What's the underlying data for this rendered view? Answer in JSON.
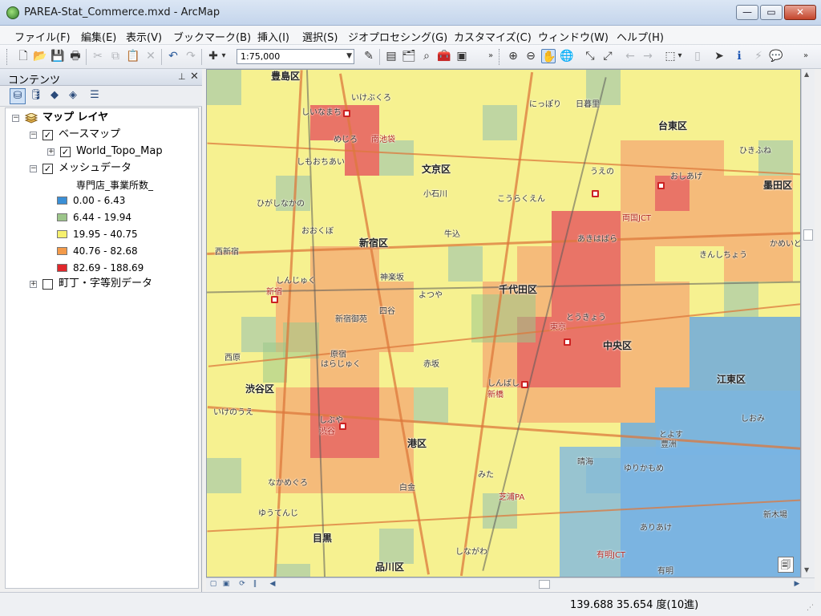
{
  "window": {
    "title": "PAREA-Stat_Commerce.mxd - ArcMap",
    "min_glyph": "—",
    "max_glyph": "▭",
    "close_glyph": "✕"
  },
  "menu": [
    "ファイル(F)",
    "編集(E)",
    "表示(V)",
    "ブックマーク(B)",
    "挿入(I)",
    "選択(S)",
    "ジオプロセシング(G)",
    "カスタマイズ(C)",
    "ウィンドウ(W)",
    "ヘルプ(H)"
  ],
  "toolbar": {
    "scale": "1:75,000",
    "scale_arrow": "▼",
    "icons": {
      "new": "🗋",
      "open": "📂",
      "save": "💾",
      "print": "🖶",
      "cut": "✂",
      "copy": "⧉",
      "paste": "📋",
      "delete": "✕",
      "undo": "↶",
      "redo": "↷",
      "add_data": "✚",
      "add_data_arrow": "▾",
      "editor": "✎",
      "table": "▤",
      "catalog": "🗂",
      "arctoolbox": "🧰",
      "search": "⌕",
      "python": "▣",
      "zoom_in": "⊕",
      "zoom_out": "⊖",
      "pan": "✋",
      "full_extent": "🌐",
      "fixed_zoom_in": "⤡",
      "fixed_zoom_out": "⤢",
      "back": "←",
      "forward": "→",
      "select_features": "⬚",
      "select_arrow": "▾",
      "clear_selection": "▯",
      "select_elements": "➤",
      "identify": "ℹ",
      "hyperlink": "⚡",
      "html_popup": "💬",
      "overflow": "»"
    }
  },
  "toc": {
    "title": "コンテンツ",
    "pin": "⊥",
    "close": "✕",
    "root_label": "マップ レイヤ",
    "check_glyph": "✓",
    "collapse_glyph": "−",
    "expand_glyph": "+",
    "layers": [
      {
        "name": "ベースマップ",
        "checked": true,
        "expanded": true
      },
      {
        "name": "World_Topo_Map",
        "checked": true,
        "expanded": false
      },
      {
        "name": "メッシュデータ",
        "checked": true,
        "expanded": true
      },
      {
        "name": "町丁・字等別データ",
        "checked": false,
        "expanded": false
      }
    ],
    "legend_field": "専門店_事業所数_",
    "legend": [
      {
        "label": "0.00 - 6.43",
        "color": "#3b8fd6"
      },
      {
        "label": "6.44 - 19.94",
        "color": "#9cc58a"
      },
      {
        "label": "19.95 - 40.75",
        "color": "#f6f06e"
      },
      {
        "label": "40.76 - 82.68",
        "color": "#f39a4a"
      },
      {
        "label": "82.69 - 188.69",
        "color": "#e0272b"
      }
    ]
  },
  "map": {
    "labels": [
      "豊島区",
      "しいなまち",
      "いけぶくろ",
      "めじろ",
      "南池袋",
      "にっぽり",
      "日暮里",
      "台東区",
      "ひきふね",
      "しもおちあい",
      "文京区",
      "うえの",
      "おしあげ",
      "墨田区",
      "こうらくえん",
      "小石川",
      "ひがしなかの",
      "おおくぼ",
      "新宿区",
      "牛込",
      "あきはばら",
      "かめいど",
      "しんじゅく",
      "新宿",
      "四谷",
      "千代田区",
      "よつや",
      "きんしちょう",
      "西新宿",
      "新宿御苑",
      "神楽坂",
      "東京",
      "とうきょう",
      "中央区",
      "江東区",
      "西原",
      "原宿",
      "はらじゅく",
      "赤坂",
      "渋谷区",
      "しぶや",
      "渋谷",
      "しんばし",
      "新橋",
      "港区",
      "いけのうえ",
      "ゆりかもめ",
      "晴海",
      "豊洲",
      "とよす",
      "しおみ",
      "新木場",
      "有明",
      "ありあけ",
      "目黒",
      "なかめぐろ",
      "ゆうてんじ",
      "品川区",
      "しながわ",
      "有明JCT",
      "芝浦PA",
      "みた",
      "白金",
      "両国JCT"
    ],
    "corner_glyph": "🗐"
  },
  "scrollbars": {
    "up": "▲",
    "down": "▼",
    "left": "◀",
    "right": "▶",
    "layout_view": "▢",
    "data_view": "▣",
    "refresh": "⟳",
    "pause": "‖"
  },
  "status": {
    "coords": "139.688  35.654 度(10進)",
    "grip": "⋰"
  }
}
